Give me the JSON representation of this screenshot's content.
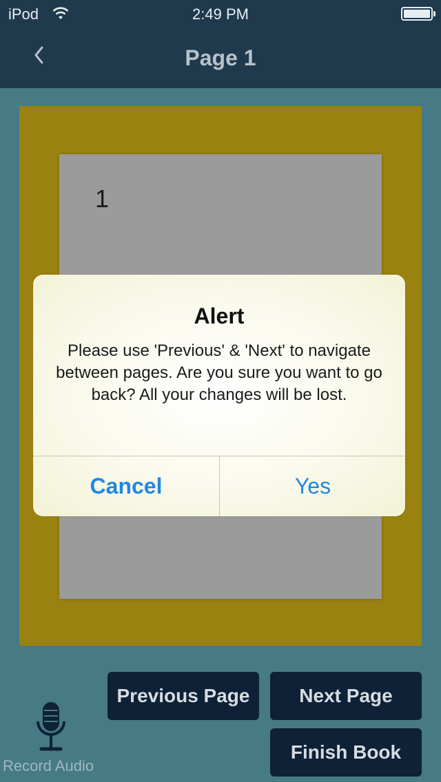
{
  "status_bar": {
    "carrier": "iPod",
    "time": "2:49 PM"
  },
  "nav_bar": {
    "title": "Page 1",
    "back_icon": "chevron-left-icon"
  },
  "page": {
    "number": "1",
    "frame_color": "#9a8211",
    "page_color": "#9b9b9b"
  },
  "alert": {
    "title": "Alert",
    "message": "Please use 'Previous' & 'Next' to navigate between pages. Are you sure you want to go back? All your changes will be lost.",
    "cancel_label": "Cancel",
    "yes_label": "Yes"
  },
  "controls": {
    "previous_label": "Previous Page",
    "next_label": "Next Page",
    "finish_label": "Finish Book",
    "record_label": "Record Audio",
    "record_icon": "microphone-icon"
  },
  "colors": {
    "background": "#467a85",
    "bar": "#1f394d",
    "button": "#0e2136",
    "accent": "#1e88e5"
  }
}
